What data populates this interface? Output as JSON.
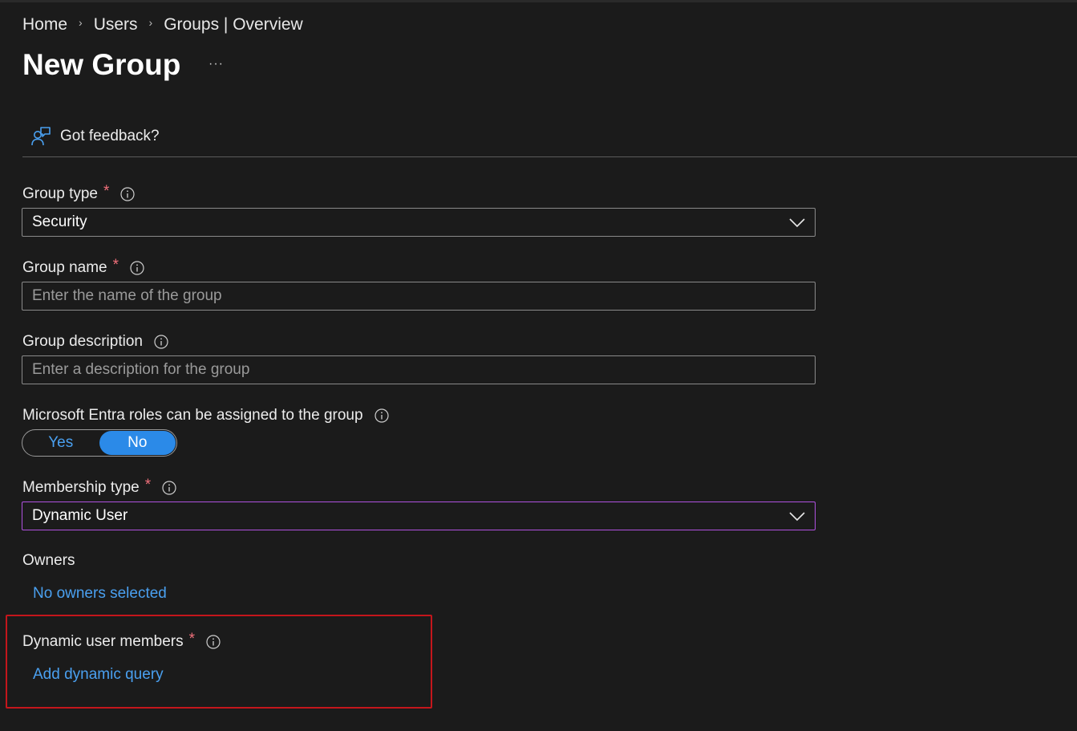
{
  "breadcrumb": {
    "items": [
      "Home",
      "Users",
      "Groups | Overview"
    ],
    "separator": "›"
  },
  "page": {
    "title": "New Group",
    "more_label": "···"
  },
  "command_bar": {
    "feedback_label": "Got feedback?"
  },
  "form": {
    "group_type": {
      "label": "Group type",
      "required_mark": "*",
      "value": "Security"
    },
    "group_name": {
      "label": "Group name",
      "required_mark": "*",
      "value": "",
      "placeholder": "Enter the name of the group"
    },
    "group_description": {
      "label": "Group description",
      "value": "",
      "placeholder": "Enter a description for the group"
    },
    "entra_roles": {
      "label": "Microsoft Entra roles can be assigned to the group",
      "options": [
        "Yes",
        "No"
      ],
      "selected": "No"
    },
    "membership_type": {
      "label": "Membership type",
      "required_mark": "*",
      "value": "Dynamic User"
    },
    "owners": {
      "label": "Owners",
      "link_label": "No owners selected"
    },
    "dynamic_members": {
      "label": "Dynamic user members",
      "required_mark": "*",
      "link_label": "Add dynamic query"
    }
  },
  "colors": {
    "background": "#1b1b1b",
    "link": "#4aa0f0",
    "toggle_selected": "#2b8ae8",
    "required": "#f1707b",
    "focus_border": "#b052e0",
    "highlight_border": "#c4161c"
  },
  "icons": {
    "feedback": "feedback-person-icon",
    "info": "info-circle-icon",
    "dropdown": "chevron-down-icon",
    "more": "more-ellipsis-icon"
  }
}
